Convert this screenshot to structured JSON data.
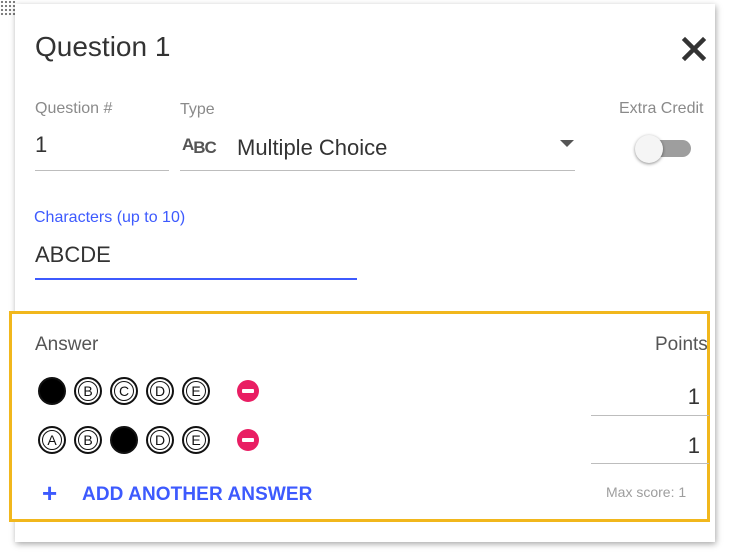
{
  "dialog": {
    "title": "Question 1"
  },
  "question_number": {
    "label": "Question #",
    "value": "1"
  },
  "type": {
    "label": "Type",
    "icon_text": "ABC",
    "selected": "Multiple Choice"
  },
  "extra_credit": {
    "label": "Extra Credit",
    "enabled": false
  },
  "characters": {
    "label": "Characters (up to 10)",
    "value": "ABCDE"
  },
  "answers": {
    "header": "Answer",
    "points_header": "Points",
    "rows": [
      {
        "bubbles": [
          {
            "letter": "A",
            "filled": true
          },
          {
            "letter": "B",
            "filled": false
          },
          {
            "letter": "C",
            "filled": false
          },
          {
            "letter": "D",
            "filled": false
          },
          {
            "letter": "E",
            "filled": false
          }
        ],
        "points": "1"
      },
      {
        "bubbles": [
          {
            "letter": "A",
            "filled": false
          },
          {
            "letter": "B",
            "filled": false
          },
          {
            "letter": "C",
            "filled": true
          },
          {
            "letter": "D",
            "filled": false
          },
          {
            "letter": "E",
            "filled": false
          }
        ],
        "points": "1"
      }
    ],
    "add_label": "ADD ANOTHER ANSWER",
    "max_score": "Max score: 1"
  },
  "colors": {
    "accent": "#3d5afe",
    "remove": "#e91e63",
    "highlight_border": "#f1b71c"
  }
}
